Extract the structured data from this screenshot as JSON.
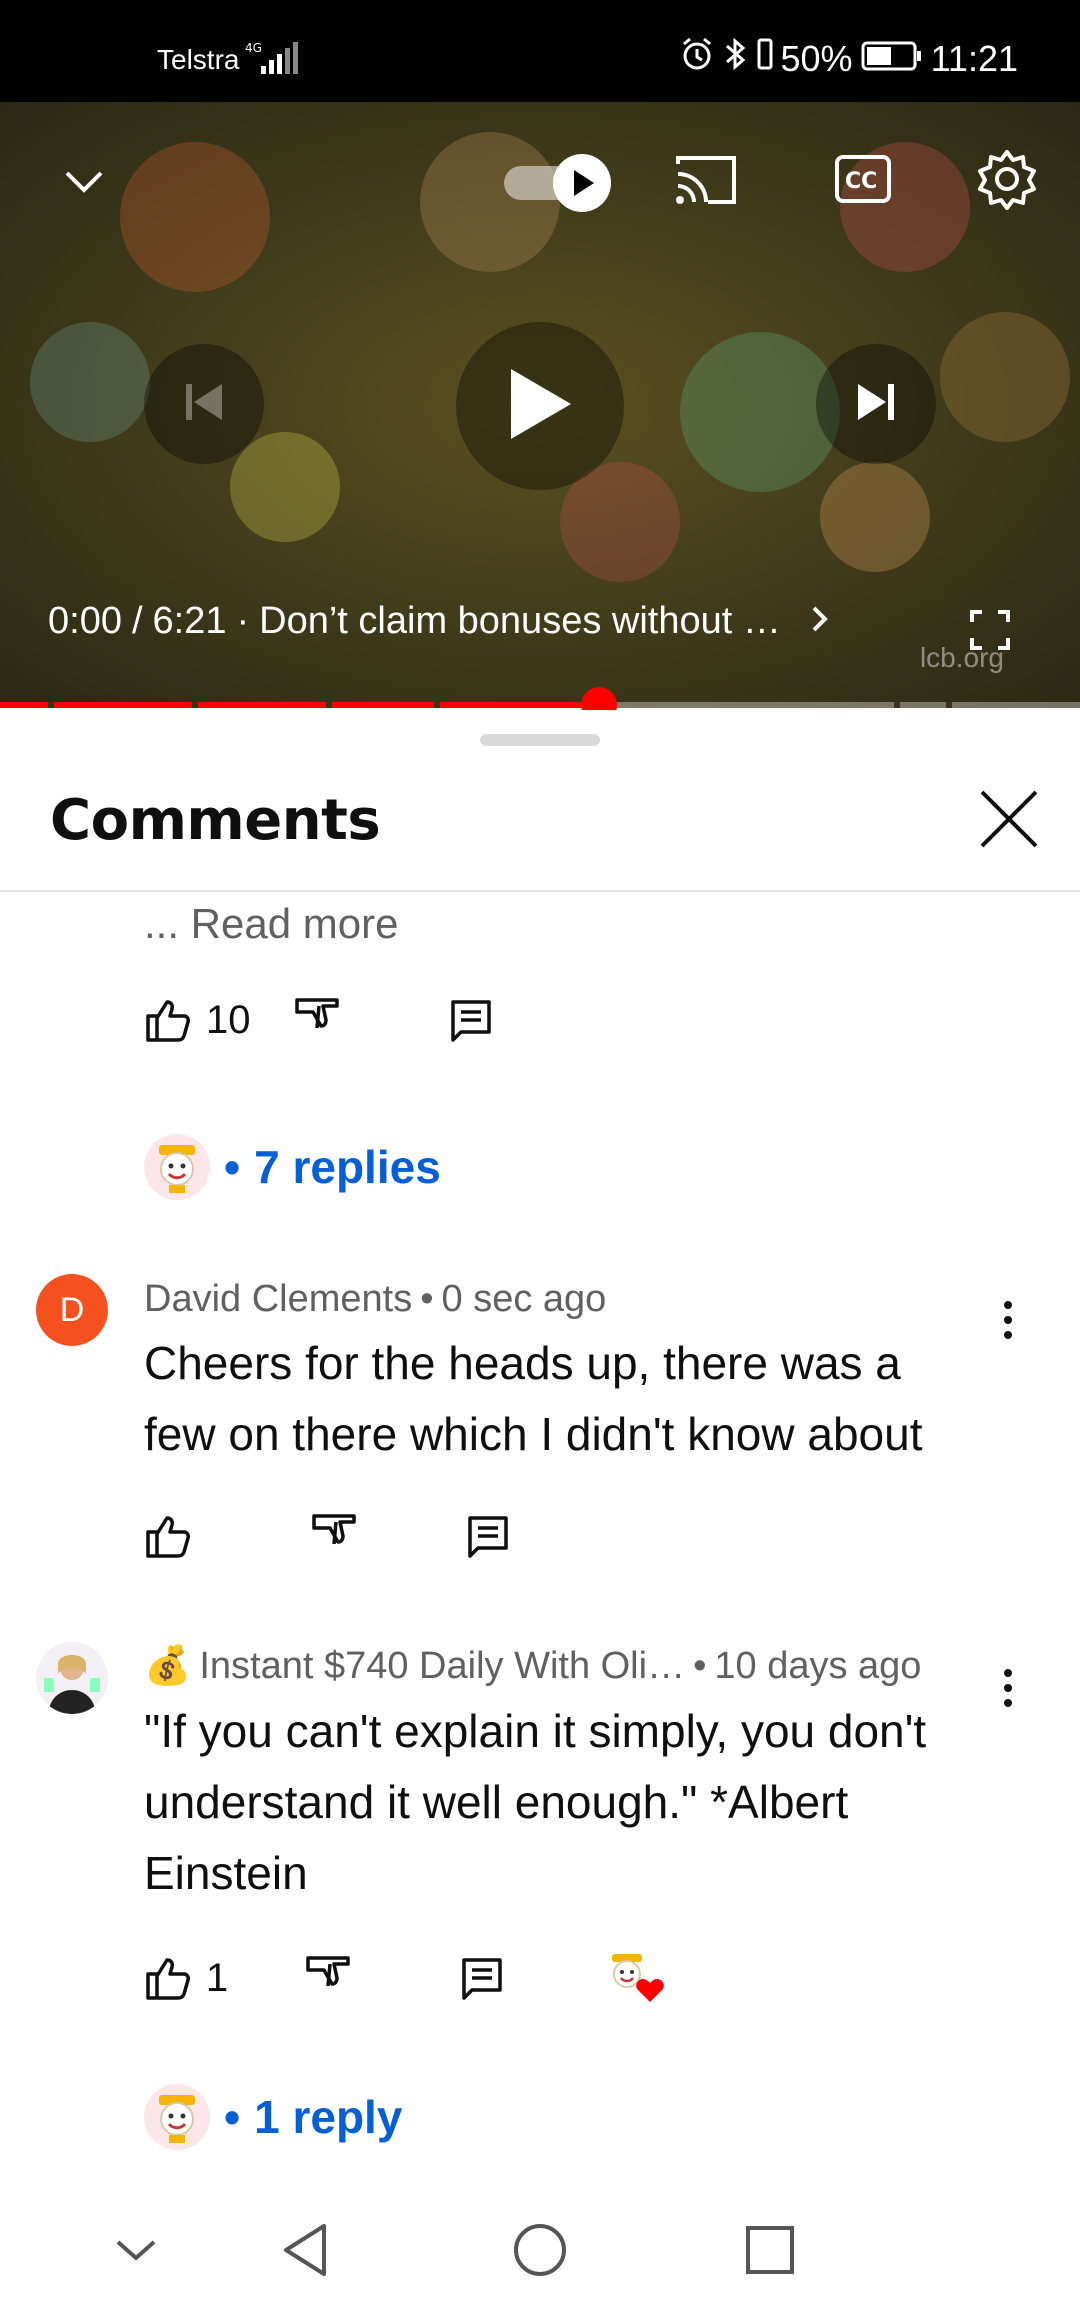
{
  "status_bar": {
    "carrier": "Telstra",
    "network": "4G",
    "battery": "50%",
    "time": "11:21"
  },
  "player": {
    "current_time": "0:00",
    "separator": "/",
    "duration": "6:21",
    "dot": "·",
    "chapter_title": "Don’t claim bonuses without …",
    "watermark": "lcb.org",
    "progress_fraction": 0.555,
    "icons": [
      "chevron-down-icon",
      "autoplay-toggle-icon",
      "cast-icon",
      "captions-icon",
      "settings-icon",
      "previous-icon",
      "play-icon",
      "next-icon",
      "fullscreen-icon"
    ],
    "autoplay_on": true
  },
  "comments_sheet": {
    "title": "Comments",
    "read_more": "... Read more",
    "first_thread": {
      "likes": "10",
      "replies_label": "7 replies"
    },
    "comments": [
      {
        "avatar_letter": "D",
        "avatar_color": "#f4511e",
        "author": "David Clements",
        "time": "0 sec ago",
        "text": "Cheers for the heads up, there was a few on there which I didn't know about",
        "likes": ""
      },
      {
        "author_prefix": "💰",
        "author": "Instant $740 Daily With Oli…",
        "time": "10 days ago",
        "text": "\"If you can't explain it simply, you don't understand it well enough.\" *Albert Einstein",
        "likes": "1",
        "creator_hearted": true,
        "replies_label": "1 reply"
      }
    ],
    "meta_dot": "•",
    "reply_dot": "•"
  },
  "colors": {
    "accent_blue": "#065fd4",
    "progress_red": "#ff0000",
    "heart_red": "#ff0000"
  }
}
